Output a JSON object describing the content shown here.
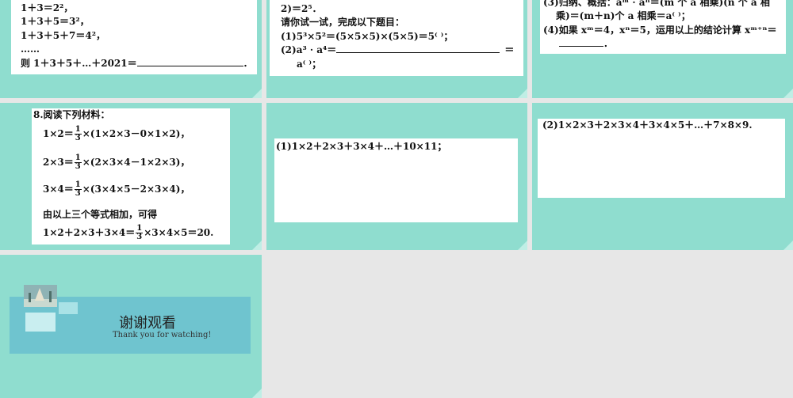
{
  "slide1": {
    "lines": [
      "1＋3＝2²，",
      "1＋3＋5＝3²，",
      "1＋3＋5＋7＝4²，",
      "……",
      "则 1＋3＋5＋…＋2021＝"
    ],
    "end_mark": "．"
  },
  "slide2": {
    "line1": "2)＝2⁵．",
    "line2": "请你试一试，完成以下题目：",
    "line3": "(1)5³×5²＝(5×5×5)×(5×5)＝5⁽  ⁾；",
    "line4": "(2)a³ · a⁴＝",
    "line4_eq": "＝",
    "line5": "a⁽  ⁾；"
  },
  "slide3": {
    "line1": "(3)归纳、概括：aᵐ · aⁿ＝(m 个 a 相乘)(n 个 a 相",
    "line2": "乘)＝(m＋n)个 a 相乘＝a⁽      ⁾；",
    "line3": "(4)如果 xᵐ＝4，xⁿ＝5，运用以上的结论计算 xᵐ⁺ⁿ＝",
    "line4_end": "．"
  },
  "slide4": {
    "heading": "8.阅读下列材料：",
    "frac_num": "1",
    "frac_den": "3",
    "eq1_left": "1×2＝",
    "eq1_right": "×(1×2×3－0×1×2)，",
    "eq2_left": "2×3＝",
    "eq2_right": "×(2×3×4－1×2×3)，",
    "eq3_left": "3×4＝",
    "eq3_right": "×(3×4×5－2×3×4)，",
    "summary": "由以上三个等式相加，可得",
    "eq4_left": "1×2＋2×3＋3×4＝",
    "eq4_right": "×3×4×5＝20."
  },
  "slide5": {
    "question": "(1)1×2＋2×3＋3×4＋…＋10×11；"
  },
  "slide6": {
    "question": "(2)1×2×3＋2×3×4＋3×4×5＋…＋7×8×9."
  },
  "slide7": {
    "title": "谢谢观看",
    "subtitle": "Thank you for watching!"
  },
  "colors": {
    "slide_bg": "#8fddcf",
    "band": "#6fc4cf",
    "page_bg": "#e7e7e7"
  }
}
